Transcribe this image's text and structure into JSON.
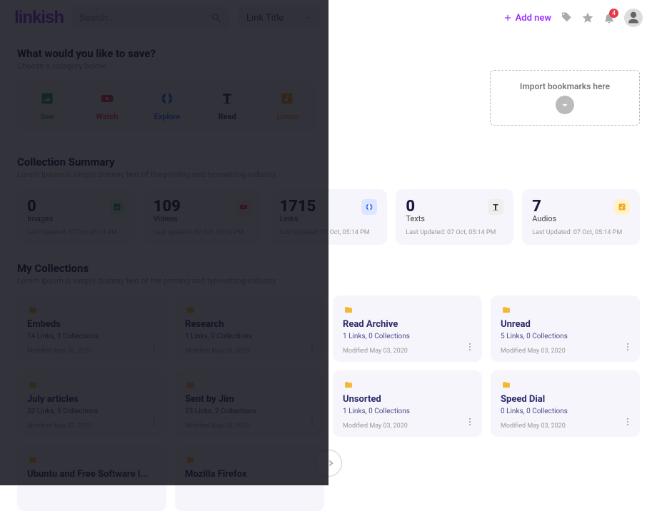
{
  "brand": "linkish",
  "search": {
    "placeholder": "Search..."
  },
  "title_select": "Link Title",
  "addnew": "Add new",
  "notif_count": "4",
  "save": {
    "heading": "What would you like to save?",
    "sub": "Choose a category below.",
    "cats": [
      {
        "key": "see",
        "label": "See"
      },
      {
        "key": "watch",
        "label": "Watch"
      },
      {
        "key": "explore",
        "label": "Explore"
      },
      {
        "key": "read",
        "label": "Read"
      },
      {
        "key": "listen",
        "label": "Listen"
      }
    ]
  },
  "import": {
    "label": "Import bookmarks here"
  },
  "summary": {
    "heading": "Collection Summary",
    "sub": "Lorem Ipsum is simply dummy text of the printing and typesetting industry.",
    "upd": "Last Updated: 07 Oct, 05:14 PM",
    "cards": [
      {
        "num": "0",
        "lbl": "Images",
        "badge": "img"
      },
      {
        "num": "109",
        "lbl": "Videos",
        "badge": "vid"
      },
      {
        "num": "1715",
        "lbl": "Links",
        "badge": "lnk"
      },
      {
        "num": "0",
        "lbl": "Texts",
        "badge": "txt"
      },
      {
        "num": "7",
        "lbl": "Audios",
        "badge": "aud"
      }
    ]
  },
  "coll": {
    "heading": "My Collections",
    "sub": "Lorem Ipsum is simply dummy text of the printing and typesetting industry.",
    "mod": "Modified May 03, 2020",
    "items": [
      {
        "name": "Embeds",
        "meta": "14 Links, 3 Collections"
      },
      {
        "name": "Research",
        "meta": "1 Links, 0 Collections"
      },
      {
        "name": "Read Archive",
        "meta": "1 Links, 0 Collections"
      },
      {
        "name": "Unread",
        "meta": "5 Links, 0 Collections"
      },
      {
        "name": "July articles",
        "meta": "32 Links, 5 Collections"
      },
      {
        "name": "Sent by Jim",
        "meta": "23 Links, 2 Collections"
      },
      {
        "name": "Unsorted",
        "meta": "1 Links, 0 Collections"
      },
      {
        "name": "Speed Dial",
        "meta": "0 Links, 0 Collections"
      },
      {
        "name": "Ubuntu and Free Software l...",
        "meta": ""
      },
      {
        "name": "Mozilla Firefox",
        "meta": ""
      }
    ]
  }
}
